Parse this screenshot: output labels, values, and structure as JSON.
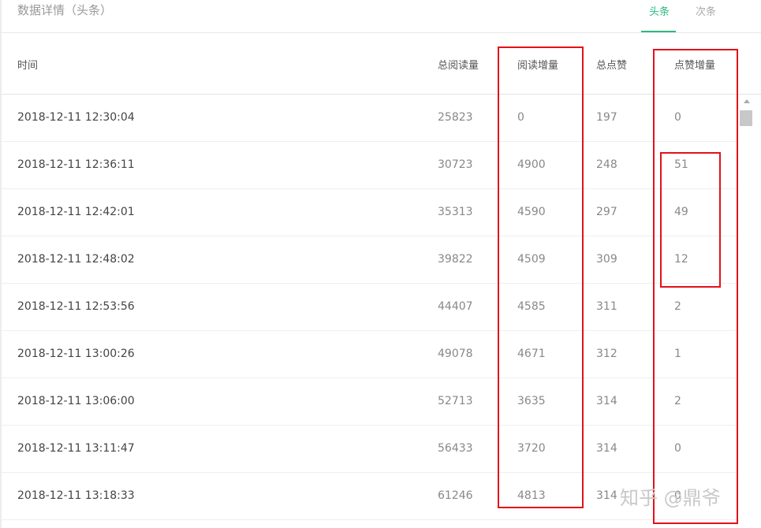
{
  "header": {
    "title": "数据详情（头条）",
    "tabs": [
      {
        "label": "头条",
        "active": true
      },
      {
        "label": "次条",
        "active": false
      }
    ]
  },
  "table": {
    "columns": [
      "时间",
      "总阅读量",
      "阅读增量",
      "总点赞",
      "点赞增量"
    ],
    "rows": [
      [
        "2018-12-11 12:30:04",
        "25823",
        "0",
        "197",
        "0"
      ],
      [
        "2018-12-11 12:36:11",
        "30723",
        "4900",
        "248",
        "51"
      ],
      [
        "2018-12-11 12:42:01",
        "35313",
        "4590",
        "297",
        "49"
      ],
      [
        "2018-12-11 12:48:02",
        "39822",
        "4509",
        "309",
        "12"
      ],
      [
        "2018-12-11 12:53:56",
        "44407",
        "4585",
        "311",
        "2"
      ],
      [
        "2018-12-11 13:00:26",
        "49078",
        "4671",
        "312",
        "1"
      ],
      [
        "2018-12-11 13:06:00",
        "52713",
        "3635",
        "314",
        "2"
      ],
      [
        "2018-12-11 13:11:47",
        "56433",
        "3720",
        "314",
        "0"
      ],
      [
        "2018-12-11 13:18:33",
        "61246",
        "4813",
        "314",
        "0"
      ]
    ]
  },
  "annotation": {
    "color": "#e3111a"
  },
  "watermark": "知乎 @鼎爷",
  "colors": {
    "accent": "#2db981"
  }
}
